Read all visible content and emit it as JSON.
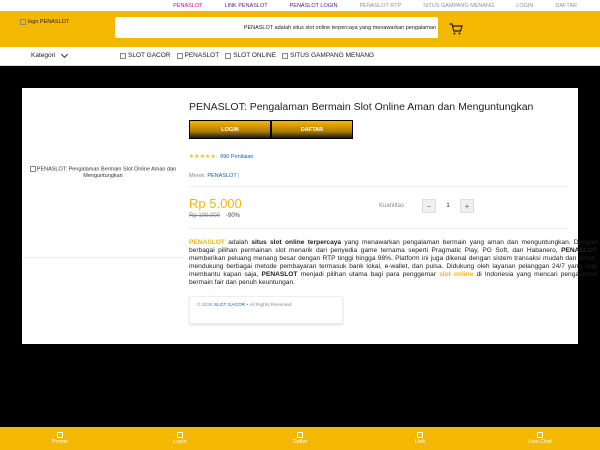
{
  "topbar": {
    "links": [
      {
        "label": "PENASLOT",
        "color": "#d6009a"
      },
      {
        "label": "LINK PENASLOT",
        "color": "#5b1a8c"
      },
      {
        "label": "PENASLOT LOGIN",
        "color": "#5b1a8c"
      },
      {
        "label": "PENASLOT RTP",
        "color": "#9b8aa0"
      },
      {
        "label": "SITUS GAMPANG MENANG",
        "color": "#9b8aa0"
      },
      {
        "label": "LOGIN",
        "color": "#9b8aa0"
      },
      {
        "label": "DAFTAR",
        "color": "#9b8aa0"
      }
    ]
  },
  "header": {
    "logo_alt": "logo PENASLOT",
    "search_text": "PENASLOT adalah situs slot online terpercaya yang menawarkan pengalaman",
    "cart_icon": "cart-icon"
  },
  "nav": {
    "kategori": "Kategori",
    "links": [
      "SLOT GACOR",
      "PENASLOT",
      "SLOT ONLINE",
      "SITUS GAMPANG MENANG"
    ]
  },
  "product": {
    "image_alt": "PENASLOT: Pengalaman Bermain Slot Online Aman dan Menguntungkan",
    "title": "PENASLOT: Pengalaman Bermain Slot Online Aman dan Menguntungkan",
    "login_label": "LOGIN",
    "daftar_label": "DAFTAR",
    "stars": "★★★★★",
    "rating_count": "990 Penilaian",
    "merek_label": "Merek:",
    "merek_value": "PENASLOT",
    "merek_sep": "|",
    "price": "Rp 5.000",
    "old_price": "Rp 100.000",
    "discount": "-90%",
    "kuantitas_label": "Kuantitas",
    "qty_minus": "−",
    "qty_value": "1",
    "qty_plus": "+",
    "desc": {
      "p1": "PENASLOT",
      "p2": " adalah ",
      "p3": "situs slot online terpercaya",
      "p4": " yang menawarkan pengalaman bermain yang aman dan menguntungkan. Dengan berbagai pilihan permainan slot menarik dari penyedia game ternama seperti Pragmatic Play, PG Soft, dan Habanero, ",
      "p5": "PENASLOT",
      "p6": " memberikan peluang menang besar dengan RTP tinggi hingga 98%. Platform ini juga dikenal dengan sistem transaksi mudah dan aman, mendukung berbagai metode pembayaran termasuk bank lokal, e-wallet, dan pulsa. Didukung oleh layanan pelanggan 24/7 yang siap membantu kapan saja, ",
      "p7": "PENASLOT",
      "p8": " menjadi pilihan utama bagi para penggemar ",
      "p9": "slot online",
      "p10": " di Indonesia yang mencari pengalaman bermain fair dan penuh keuntungan."
    },
    "footer_prefix": "© 2025 ",
    "footer_link": "SLOT GACOR",
    "footer_suffix": " • All Rights Reserved."
  },
  "bottom_nav": [
    "Promo",
    "Login",
    "Daftar",
    "Link",
    "Live Chat"
  ],
  "colors": {
    "accent": "#f5b800",
    "link": "#1e5eb8"
  }
}
